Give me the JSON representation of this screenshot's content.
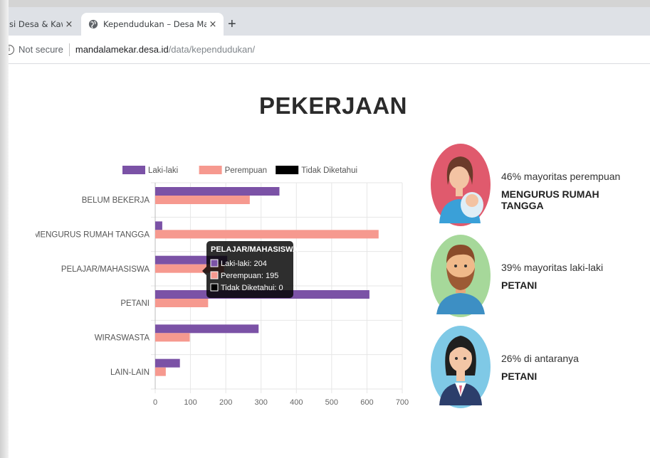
{
  "browser": {
    "inactive_tab_title": "asi Desa & Kawasa",
    "active_tab_title": "Kependudukan – Desa Mandalam",
    "close_glyph": "×",
    "new_tab_glyph": "+",
    "security_label": "Not secure",
    "url_host": "mandalamekar.desa.id",
    "url_path": "/data/kependudukan/"
  },
  "page": {
    "title": "PEKERJAAN"
  },
  "chart_data": {
    "type": "bar",
    "orientation": "horizontal",
    "categories": [
      "BELUM BEKERJA",
      "MENGURUS RUMAH TANGGA",
      "PELAJAR/MAHASISWA",
      "PETANI",
      "WIRASWASTA",
      "LAIN-LAIN"
    ],
    "series": [
      {
        "name": "Laki-laki",
        "color": "#7b52a6",
        "values": [
          352,
          20,
          204,
          607,
          293,
          70
        ]
      },
      {
        "name": "Perempuan",
        "color": "#f6998f",
        "values": [
          268,
          633,
          195,
          150,
          98,
          30
        ]
      },
      {
        "name": "Tidak Diketahui",
        "color": "#000000",
        "values": [
          0,
          0,
          0,
          0,
          0,
          0
        ]
      }
    ],
    "xlim": [
      0,
      700
    ],
    "xticks": [
      "0",
      "100",
      "200",
      "300",
      "400",
      "500",
      "600",
      "700"
    ],
    "grid": true,
    "legend": "top",
    "tooltip": {
      "title": "PELAJAR/MAHASISWA",
      "lines": [
        "Laki-laki: 204",
        "Perempuan: 195",
        "Tidak Diketahui: 0"
      ]
    }
  },
  "highlights": [
    {
      "percent_text": "46% mayoritas perempuan",
      "label": "MENGURUS RUMAH TANGGA",
      "icon": "mother-baby-avatar",
      "bg": "#e05a6d"
    },
    {
      "percent_text": "39% mayoritas laki-laki",
      "label": "PETANI",
      "icon": "bearded-man-avatar",
      "bg": "#a6d89a"
    },
    {
      "percent_text": "26% di antaranya",
      "label": "PETANI",
      "icon": "woman-uniform-avatar",
      "bg": "#7fc9e6"
    }
  ]
}
